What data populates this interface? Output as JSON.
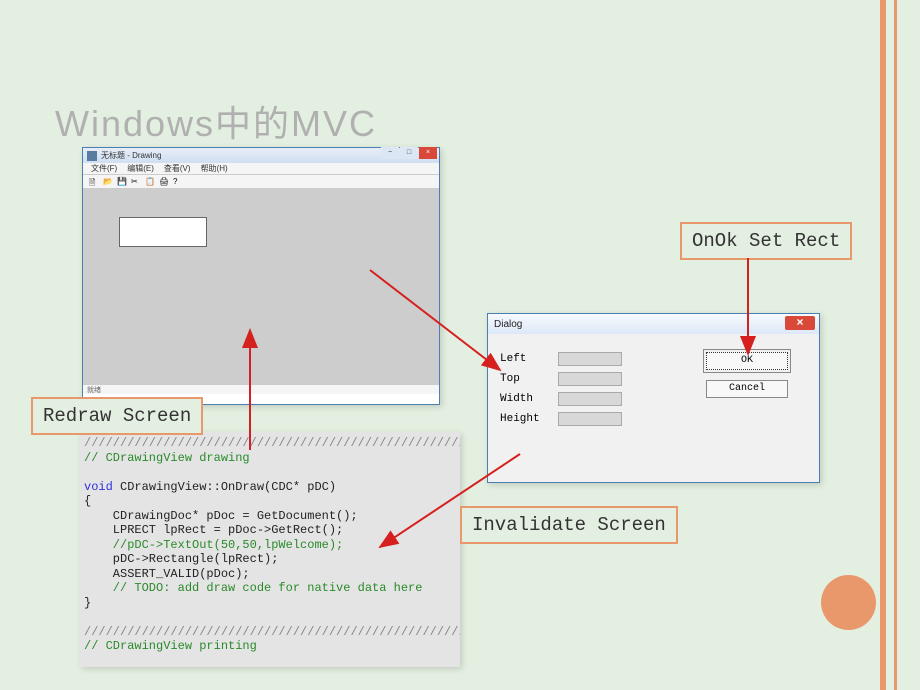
{
  "slide": {
    "title": "Windows中的MVC"
  },
  "drawing_window": {
    "title": "无标题 - Drawing",
    "menu": [
      "文件(F)",
      "编辑(E)",
      "查看(V)",
      "帮助(H)"
    ],
    "status": "就绪"
  },
  "dialog": {
    "title": "Dialog",
    "fields": {
      "left": "Left",
      "top": "Top",
      "width": "Width",
      "height": "Height"
    },
    "ok_label": "OK",
    "cancel_label": "Cancel"
  },
  "callouts": {
    "onok": "OnOk Set Rect",
    "redraw": "Redraw Screen",
    "invalidate": "Invalidate Screen"
  },
  "code": {
    "l1": "/////////////////////////////////////////////////////",
    "l2": "// CDrawingView drawing",
    "l3_kw": "void",
    "l3_rest": " CDrawingView::OnDraw(CDC* pDC)",
    "l4": "{",
    "l5": "    CDrawingDoc* pDoc = GetDocument();",
    "l6": "    LPRECT lpRect = pDoc->GetRect();",
    "l7": "    //pDC->TextOut(50,50,lpWelcome);",
    "l8": "    pDC->Rectangle(lpRect);",
    "l9": "    ASSERT_VALID(pDoc);",
    "l10": "    // TODO: add draw code for native data here",
    "l11": "}",
    "l12": "",
    "l13": "/////////////////////////////////////////////////////",
    "l14": "// CDrawingView printing"
  }
}
